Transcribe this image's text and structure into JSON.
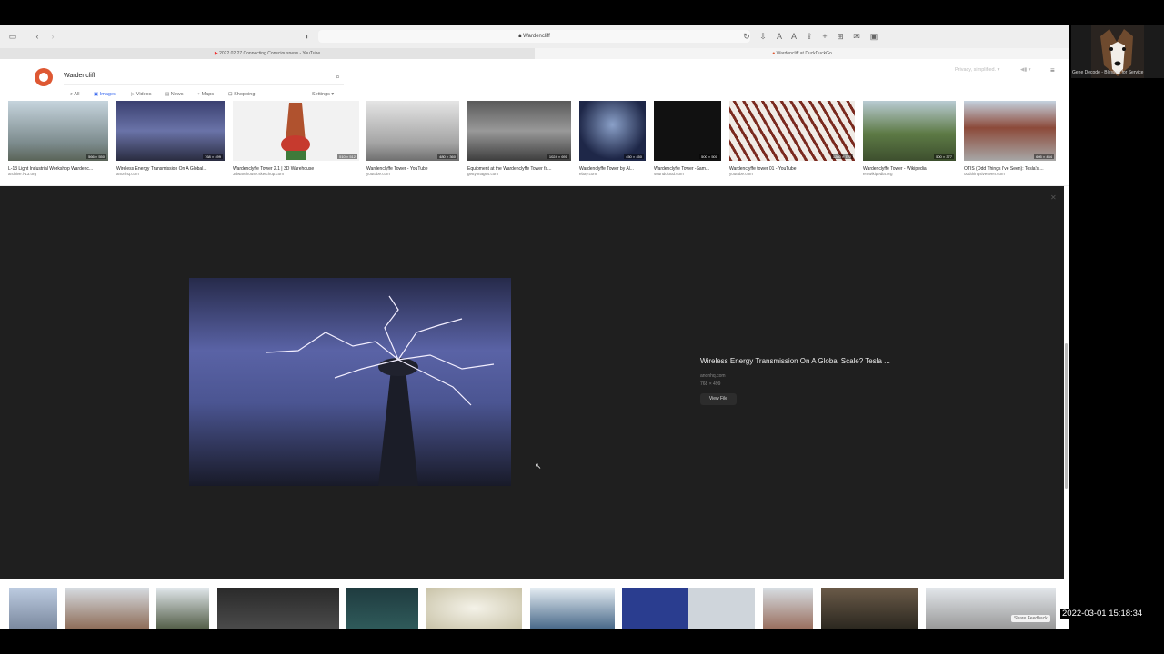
{
  "browser": {
    "address": "Wardencliff",
    "tabs": [
      "2022 02 27 Connecting Consciousness - YouTube",
      "Wardencliff at DuckDuckGo"
    ]
  },
  "search": {
    "query": "Wardencliff",
    "nav": [
      "All",
      "Images",
      "Videos",
      "News",
      "Maps",
      "Shopping"
    ],
    "settings": "Settings",
    "privacy": "Privacy, simplified."
  },
  "thumbnails": [
    {
      "title": "L-13 Light Industrial Workshop Wardenc...",
      "source": "archive.l-13.org",
      "dims": "566 × 550"
    },
    {
      "title": "Wireless Energy Transmission On A Global...",
      "source": "anonhq.com",
      "dims": "768 × 499"
    },
    {
      "title": "Wardenclyffe Tower 2.1 | 3D Warehouse",
      "source": "3dwarehouse.sketchup.com",
      "dims": "510 × 512"
    },
    {
      "title": "Wardenclyffe Tower - YouTube",
      "source": "youtube.com",
      "dims": "480 × 360"
    },
    {
      "title": "Equipment at the Wardenclyffe Tower fa...",
      "source": "gettyimages.com",
      "dims": "1024 × 691"
    },
    {
      "title": "Wardenclyffe Tower by Al...",
      "source": "ebay.com",
      "dims": "450 × 450"
    },
    {
      "title": "Wardenclyffe Tower -Sam...",
      "source": "soundcloud.com",
      "dims": "500 × 500"
    },
    {
      "title": "Wardenclyffe tower 01 - YouTube",
      "source": "youtube.com",
      "dims": "1280 × 720"
    },
    {
      "title": "Wardenclyffe Tower - Wikipedia",
      "source": "en.wikipedia.org",
      "dims": "500 × 377"
    },
    {
      "title": "OTIS (Odd Things I've Seen): Tesla's ...",
      "source": "oddthingsiveseen.com",
      "dims": "605 × 454"
    }
  ],
  "detail": {
    "title": "Wireless Energy Transmission On A Global Scale? Tesla ...",
    "source": "anonhq.com",
    "dims": "768 × 499",
    "button": "View File"
  },
  "camera": {
    "name": "Gene Decode - Blessed for Service"
  },
  "timestamp": "2022-03-01  15:18:34",
  "feedback": "Share Feedback",
  "colors": {
    "accent": "#3969ef",
    "ddg_orange": "#de5833",
    "panel": "#1f1f1f"
  }
}
